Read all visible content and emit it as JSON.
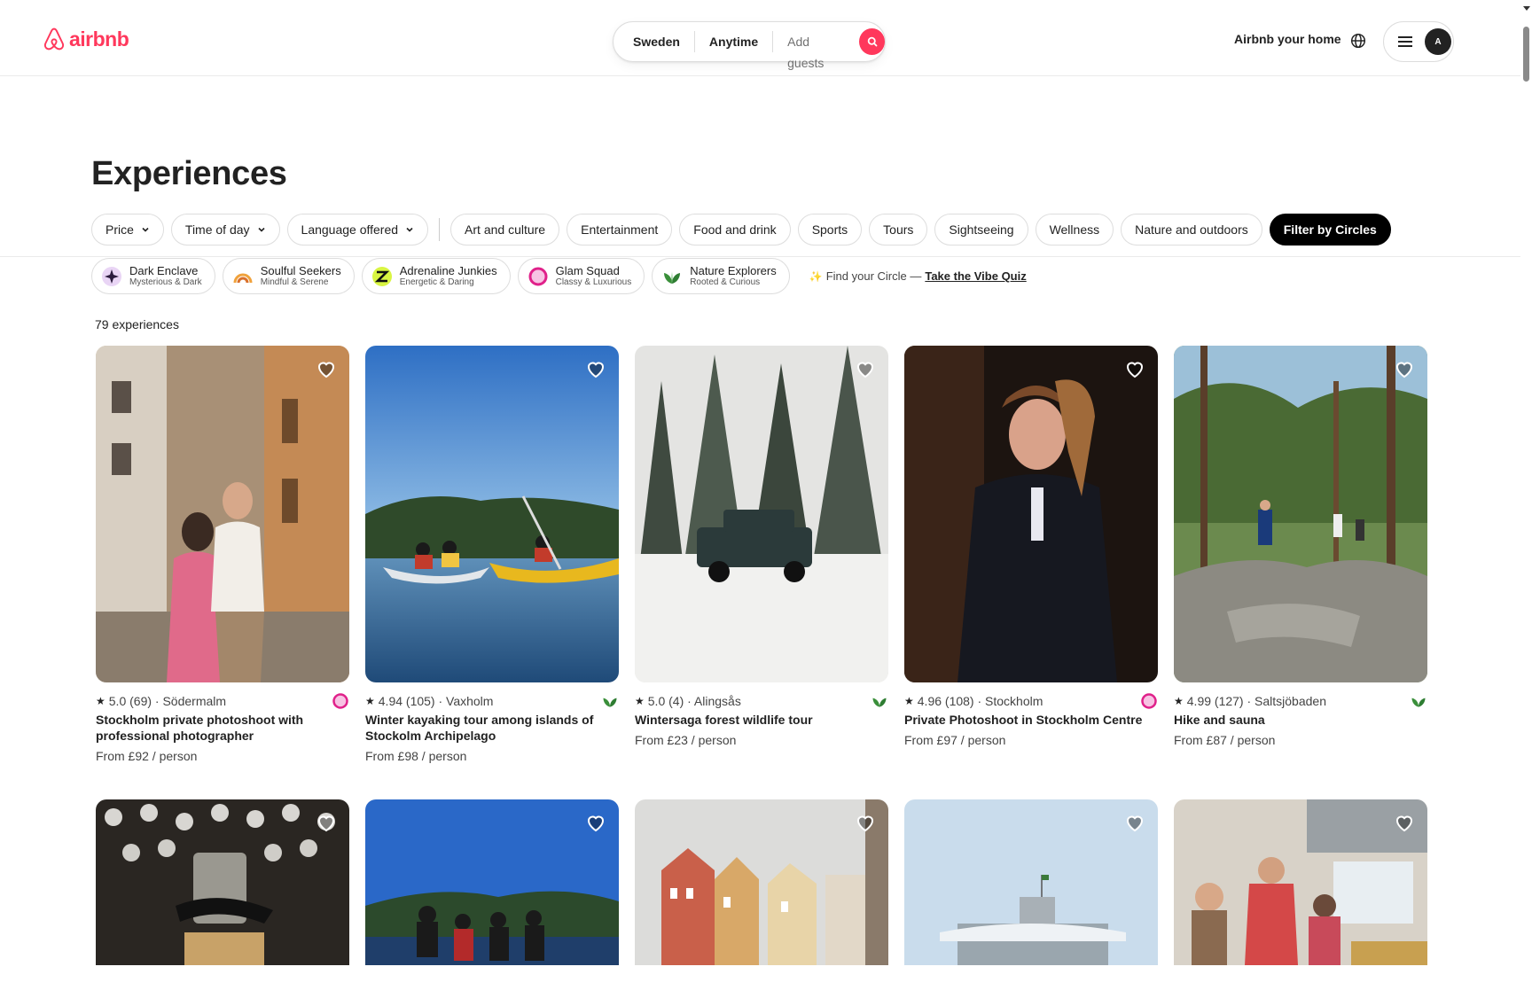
{
  "header": {
    "logo_text": "airbnb",
    "search": {
      "location": "Sweden",
      "dates": "Anytime",
      "guests": "Add guests"
    },
    "host_link": "Airbnb your home",
    "avatar_initial": "A"
  },
  "page": {
    "title": "Experiences",
    "count": "79 experiences"
  },
  "filters": {
    "dropdowns": [
      "Price",
      "Time of day",
      "Language offered"
    ],
    "categories": [
      "Art and culture",
      "Entertainment",
      "Food and drink",
      "Sports",
      "Tours",
      "Sightseeing",
      "Wellness",
      "Nature and outdoors"
    ],
    "active": "Filter by Circles"
  },
  "circles": [
    {
      "name": "Dark Enclave",
      "sub": "Mysterious & Dark",
      "icon": "sparkle-icon"
    },
    {
      "name": "Soulful Seekers",
      "sub": "Mindful & Serene",
      "icon": "rainbow-icon"
    },
    {
      "name": "Adrenaline Junkies",
      "sub": "Energetic & Daring",
      "icon": "zigzag-icon"
    },
    {
      "name": "Glam Squad",
      "sub": "Classy & Luxurious",
      "icon": "pink-ring-icon"
    },
    {
      "name": "Nature Explorers",
      "sub": "Rooted & Curious",
      "icon": "leaf-icon"
    }
  ],
  "quiz": {
    "prefix": "Find your Circle —",
    "link": "Take the Vibe Quiz"
  },
  "cards": [
    {
      "rating": "5.0 (69) · Södermalm",
      "title": "Stockholm private photoshoot with professional photographer",
      "price": "From £92 / person",
      "badge": "pink-ring-icon"
    },
    {
      "rating": "4.94 (105) · Vaxholm",
      "title": "Winter kayaking tour among islands of Stockolm Archipelago",
      "price": "From £98 / person",
      "badge": "leaf-icon"
    },
    {
      "rating": "5.0 (4) · Alingsås",
      "title": "Wintersaga forest wildlife tour",
      "price": "From £23 / person",
      "badge": "leaf-icon"
    },
    {
      "rating": "4.96 (108) · Stockholm",
      "title": "Private Photoshoot in Stockholm Centre",
      "price": "From £97 / person",
      "badge": "pink-ring-icon"
    },
    {
      "rating": "4.99 (127) · Saltsjöbaden",
      "title": "Hike and sauna",
      "price": "From £87 / person",
      "badge": "leaf-icon"
    }
  ],
  "colors": {
    "brand": "#ff385c",
    "glam": "#e0218a",
    "nature": "#2e7d32"
  }
}
